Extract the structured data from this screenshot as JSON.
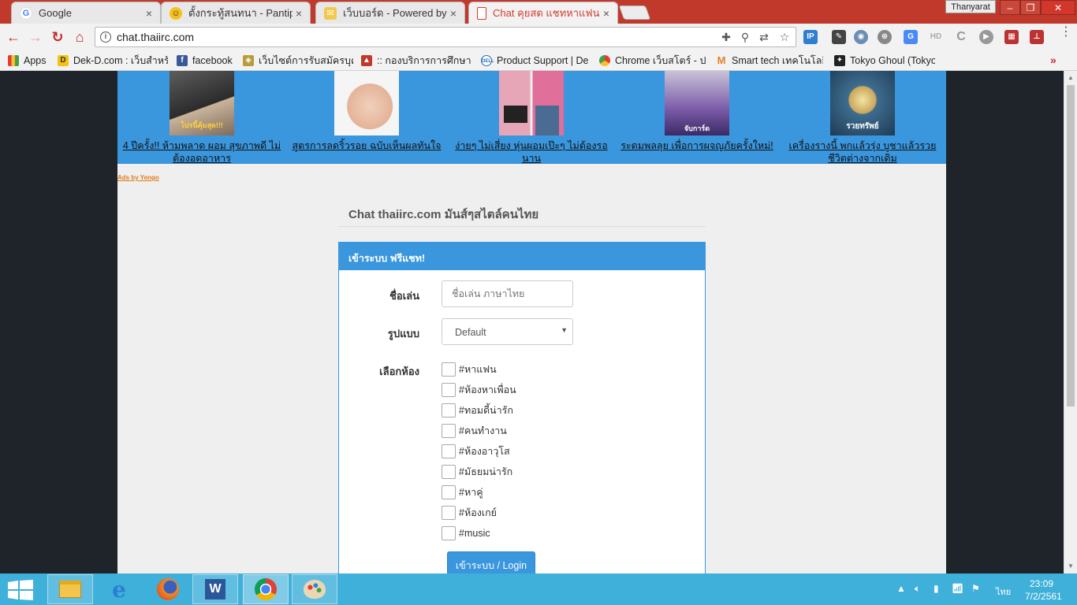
{
  "browser": {
    "tabs": [
      {
        "title": "Google",
        "active": false
      },
      {
        "title": "ตั้งกระทู้สนทนา - Pantip",
        "active": false
      },
      {
        "title": "เว็บบอร์ด - Powered by Di",
        "active": false
      },
      {
        "title": "Chat คุยสด แชทหาแฟน แช",
        "active": true
      }
    ],
    "tab_close": "×",
    "profile_name": "Thanyarat",
    "window_min": "–",
    "window_max": "❐",
    "window_close": "✕",
    "url": "chat.thaiirc.com",
    "bookmarks": [
      {
        "label": "Apps",
        "icon": "apps-grid-icon"
      },
      {
        "label": "Dek-D.com : เว็บสำหรั",
        "icon": "dekd-icon"
      },
      {
        "label": "facebook",
        "icon": "facebook-icon"
      },
      {
        "label": "เว็บไซต์การรับสมัครบุคล",
        "icon": "gov-site-icon"
      },
      {
        "label": ":: กองบริการการศึกษา ม",
        "icon": "education-icon"
      },
      {
        "label": "Product Support | De",
        "icon": "dell-icon"
      },
      {
        "label": "Chrome เว็บสโตร์ - ประ",
        "icon": "chrome-store-icon"
      },
      {
        "label": "Smart tech เทคโนโลยี",
        "icon": "gmail-icon"
      },
      {
        "label": "Tokyo Ghoul (Tokyo",
        "icon": "tokyo-ghoul-icon"
      }
    ],
    "bookmarks_more": "»"
  },
  "ads": {
    "items": [
      {
        "caption": "4 ปีครั้ง!! ห้ามพลาด ผอม สุขภาพดี ไม่ต้องอดอาหาร",
        "thumb_text": "โปรนี้คุ้มสุด!!!"
      },
      {
        "caption": "สูตรการลดริ้วรอย ฉบับเห็นผลทันใจ",
        "thumb_text": ""
      },
      {
        "caption": "ง่ายๆ ไม่เสี่ยง หุ่นผอมเป๊ะๆ ไม่ต้องรอนาน",
        "thumb_text": ""
      },
      {
        "caption": "ระดมพลลุย เพื่อการผจญภัยครั้งใหม่!",
        "thumb_text": "จับการ์ด"
      },
      {
        "caption": "เครื่องรางนี้ พกแล้วรุ่ง บูชาแล้วรวย ชีวิตต่างจากเดิม",
        "thumb_text": "รวยทรัพย์"
      }
    ],
    "ads_by": "Ads by Yengo"
  },
  "page": {
    "headline": "Chat thaiirc.com มันส์ๆสไตล์คนไทย",
    "panel_title": "เข้าระบบ ฟรีแชท!",
    "nick_label": "ชื่อเล่น",
    "nick_placeholder": "ชื่อเล่น ภาษาไทย",
    "style_label": "รูปแบบ",
    "style_value": "Default",
    "style_caret": "▼",
    "room_label": "เลือกห้อง",
    "rooms": [
      "#หาแฟน",
      "#ห้องหาเพื่อน",
      "#ทอมดี้น่ารัก",
      "#คนทำงาน",
      "#ห้องอาวุโส",
      "#มัธยมน่ารัก",
      "#หาคู่",
      "#ห้องเกย์",
      "#music"
    ],
    "login_button": "เข้าระบบ / Login"
  },
  "taskbar": {
    "apps": [
      "file-explorer-icon",
      "internet-explorer-icon",
      "firefox-icon",
      "word-icon",
      "chrome-icon",
      "paint-icon"
    ],
    "language": "ไทย",
    "time": "23:09",
    "date": "7/2/2561"
  },
  "colors": {
    "accent_blue": "#3a96dd",
    "chrome_red": "#c0392b",
    "taskbar": "#3fb0d9"
  }
}
